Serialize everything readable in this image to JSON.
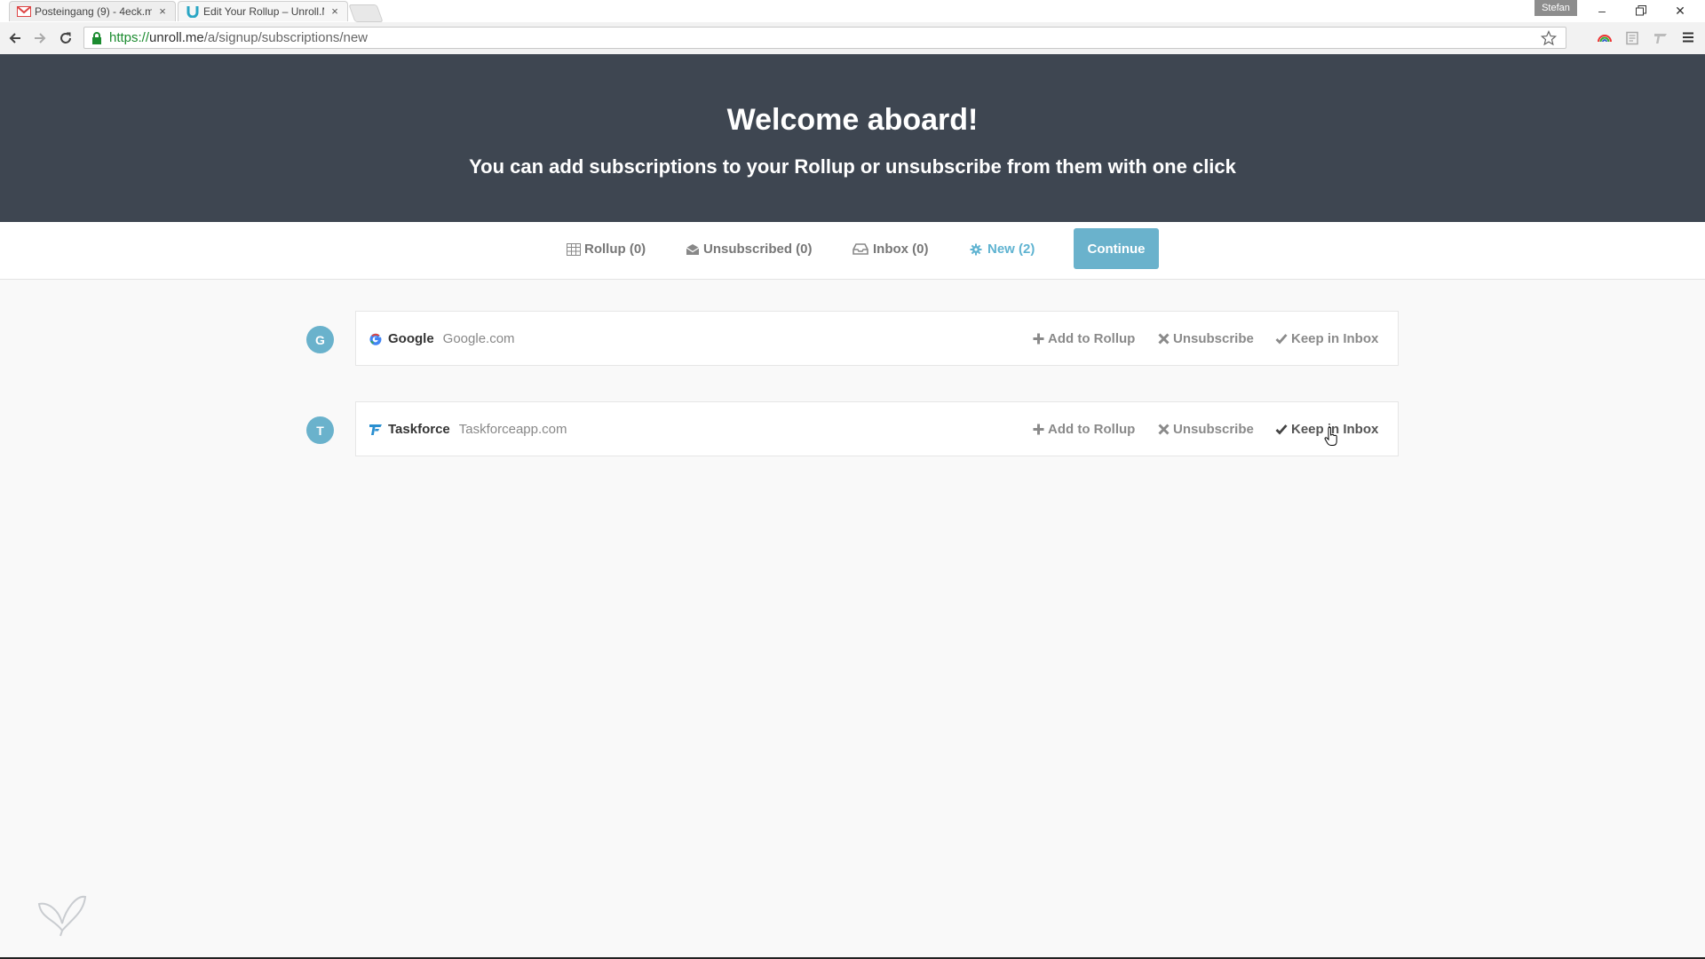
{
  "browser": {
    "tabs": [
      {
        "title": "Posteingang (9) - 4eck.me",
        "favicon": "gmail-icon"
      },
      {
        "title": "Edit Your Rollup – Unroll.Me",
        "favicon": "unrollme-icon"
      }
    ],
    "profile_name": "Stefan",
    "url": {
      "scheme": "https://",
      "host": "unroll.me",
      "path": "/a/signup/subscriptions/new"
    }
  },
  "hero": {
    "title": "Welcome aboard!",
    "subtitle": "You can add subscriptions to your Rollup or unsubscribe from them with one click"
  },
  "filters": [
    {
      "label": "Rollup (0)",
      "icon": "rollup-icon",
      "active": false
    },
    {
      "label": "Unsubscribed (0)",
      "icon": "unsubscribed-icon",
      "active": false
    },
    {
      "label": "Inbox (0)",
      "icon": "inbox-icon",
      "active": false
    },
    {
      "label": "New (2)",
      "icon": "new-icon",
      "active": true
    }
  ],
  "continue_label": "Continue",
  "subscriptions": [
    {
      "initial": "G",
      "name": "Google",
      "domain": "Google.com",
      "logo": "google-logo-icon"
    },
    {
      "initial": "T",
      "name": "Taskforce",
      "domain": "Taskforceapp.com",
      "logo": "taskforce-logo-icon"
    }
  ],
  "actions": {
    "add": "Add to Rollup",
    "unsubscribe": "Unsubscribe",
    "keep": "Keep in Inbox"
  },
  "colors": {
    "hero_bg": "#3e4651",
    "accent": "#6ab2cc",
    "active_filter": "#5fb3d1"
  }
}
